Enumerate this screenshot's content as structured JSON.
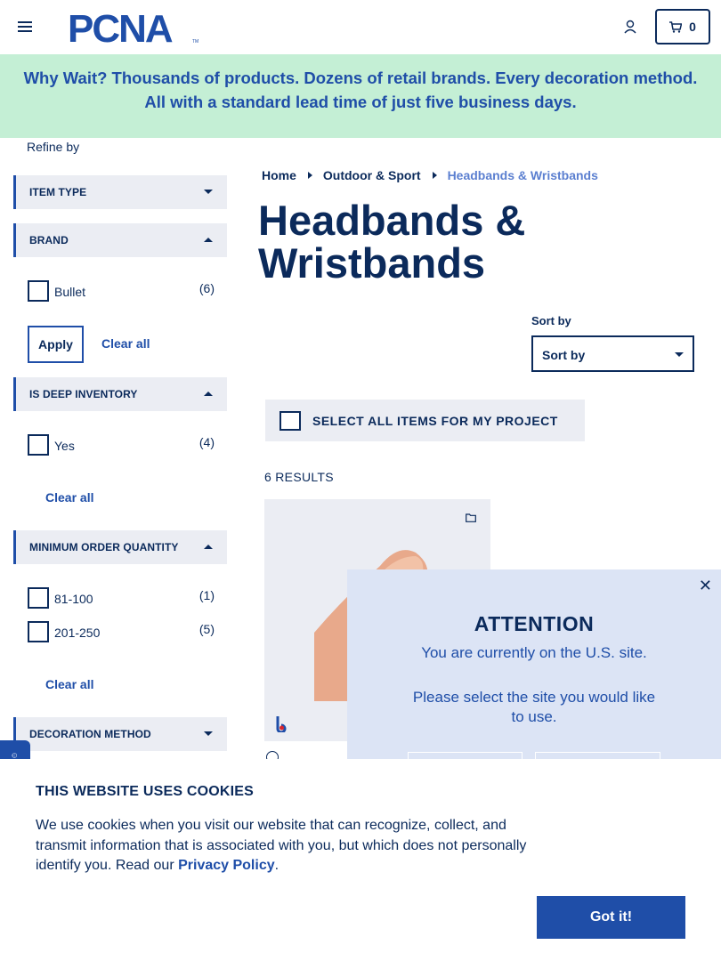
{
  "header": {
    "logo_text": "PCNA",
    "cart_count": "0"
  },
  "banner": {
    "text": "Why Wait? Thousands of products. Dozens of retail brands. Every decoration method. All with a standard lead time of just five business days."
  },
  "sidebar": {
    "refine_label": "Refine by",
    "facets": {
      "item_type": {
        "label": "ITEM TYPE"
      },
      "brand": {
        "label": "BRAND",
        "options": [
          {
            "label": "Bullet",
            "count": "(6)"
          }
        ],
        "apply_label": "Apply",
        "clear_label": "Clear all"
      },
      "deep_inventory": {
        "label": "IS DEEP INVENTORY",
        "options": [
          {
            "label": "Yes",
            "count": "(4)"
          }
        ],
        "clear_label": "Clear all"
      },
      "min_order_qty": {
        "label": "MINIMUM ORDER QUANTITY",
        "options": [
          {
            "label": "81-100",
            "count": "(1)"
          },
          {
            "label": "201-250",
            "count": "(5)"
          }
        ],
        "clear_label": "Clear all"
      },
      "decoration_method": {
        "label": "DECORATION METHOD"
      }
    }
  },
  "main": {
    "breadcrumb": [
      "Home",
      "Outdoor & Sport",
      "Headbands & Wristbands"
    ],
    "title": "Headbands & Wristbands",
    "sort_label": "Sort by",
    "sort_value": "Sort by",
    "select_all_label": "SELECT ALL ITEMS FOR MY PROJECT",
    "results_count": "6 RESULTS"
  },
  "modal": {
    "title": "ATTENTION",
    "line1": "You are currently on the U.S. site.",
    "line2": "Please select the site you would like to use.",
    "close_glyph": "✕"
  },
  "cookie": {
    "title": "THIS WEBSITE USES COOKIES",
    "text": "We use cookies when you visit our website that can recognize, collect, and transmit information that is associated with you, but which does not personally identify you. Read our ",
    "link": "Privacy Policy",
    "text_end": ".",
    "button": "Got it!"
  },
  "colors": {
    "navy": "#0b2a5b",
    "blue": "#1f4ea8",
    "banner_bg": "#c4efd5",
    "panel_bg": "#ebedf3",
    "modal_bg": "#dce4f5"
  }
}
